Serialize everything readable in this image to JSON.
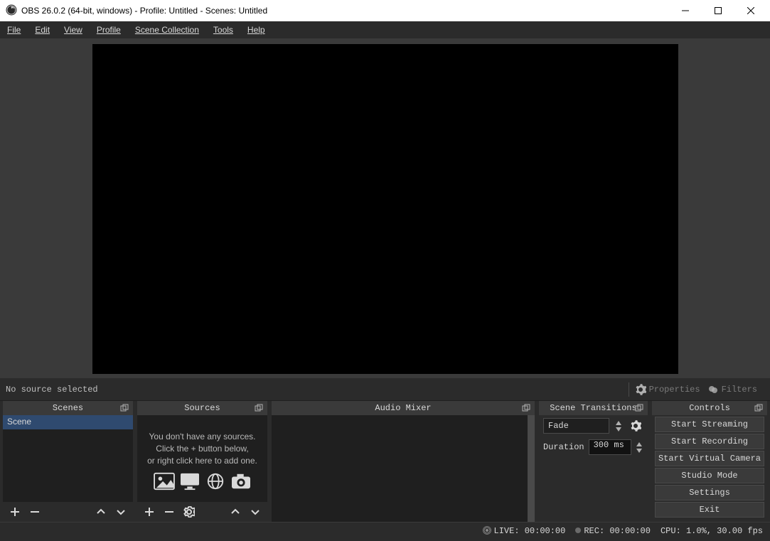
{
  "titlebar": {
    "title": "OBS 26.0.2 (64-bit, windows) - Profile: Untitled - Scenes: Untitled"
  },
  "menubar": {
    "file": "File",
    "edit": "Edit",
    "view": "View",
    "profile": "Profile",
    "scene_collection": "Scene Collection",
    "tools": "Tools",
    "help": "Help"
  },
  "infobar": {
    "no_source": "No source selected",
    "properties": "Properties",
    "filters": "Filters"
  },
  "docks": {
    "scenes": {
      "title": "Scenes",
      "item": "Scene"
    },
    "sources": {
      "title": "Sources",
      "empty_line1": "You don't have any sources.",
      "empty_line2": "Click the + button below,",
      "empty_line3": "or right click here to add one."
    },
    "mixer": {
      "title": "Audio Mixer"
    },
    "transitions": {
      "title": "Scene Transitions",
      "selected": "Fade",
      "duration_label": "Duration",
      "duration_value": "300 ms"
    },
    "controls": {
      "title": "Controls",
      "start_streaming": "Start Streaming",
      "start_recording": "Start Recording",
      "start_virtualcam": "Start Virtual Camera",
      "studio_mode": "Studio Mode",
      "settings": "Settings",
      "exit": "Exit"
    }
  },
  "statusbar": {
    "live": "LIVE: 00:00:00",
    "rec": "REC: 00:00:00",
    "cpu": "CPU: 1.0%, 30.00 fps"
  }
}
